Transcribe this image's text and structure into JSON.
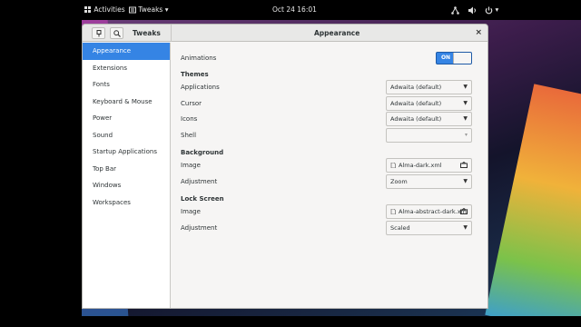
{
  "topbar": {
    "activities": "Activities",
    "app_menu": "Tweaks",
    "clock": "Oct 24  16:01"
  },
  "window": {
    "sidebar_title": "Tweaks",
    "title": "Appearance",
    "close_symbol": "×"
  },
  "sidebar": {
    "items": [
      {
        "label": "Appearance",
        "active": true
      },
      {
        "label": "Extensions"
      },
      {
        "label": "Fonts"
      },
      {
        "label": "Keyboard & Mouse"
      },
      {
        "label": "Power"
      },
      {
        "label": "Sound"
      },
      {
        "label": "Startup Applications"
      },
      {
        "label": "Top Bar"
      },
      {
        "label": "Windows"
      },
      {
        "label": "Workspaces"
      }
    ]
  },
  "main": {
    "animations_label": "Animations",
    "animations_state": "ON",
    "themes_heading": "Themes",
    "applications_label": "Applications",
    "applications_value": "Adwaita (default)",
    "cursor_label": "Cursor",
    "cursor_value": "Adwaita (default)",
    "icons_label": "Icons",
    "icons_value": "Adwaita (default)",
    "shell_label": "Shell",
    "shell_value": "",
    "background_heading": "Background",
    "bg_image_label": "Image",
    "bg_image_value": "Alma-dark.xml",
    "bg_adjustment_label": "Adjustment",
    "bg_adjustment_value": "Zoom",
    "lock_heading": "Lock Screen",
    "lock_image_label": "Image",
    "lock_image_value": "Alma-abstract-dark.xml",
    "lock_adjustment_label": "Adjustment",
    "lock_adjustment_value": "Scaled"
  },
  "colors": {
    "accent": "#3584e4",
    "window_bg": "#f6f5f4",
    "sidebar_bg": "#ffffff"
  }
}
